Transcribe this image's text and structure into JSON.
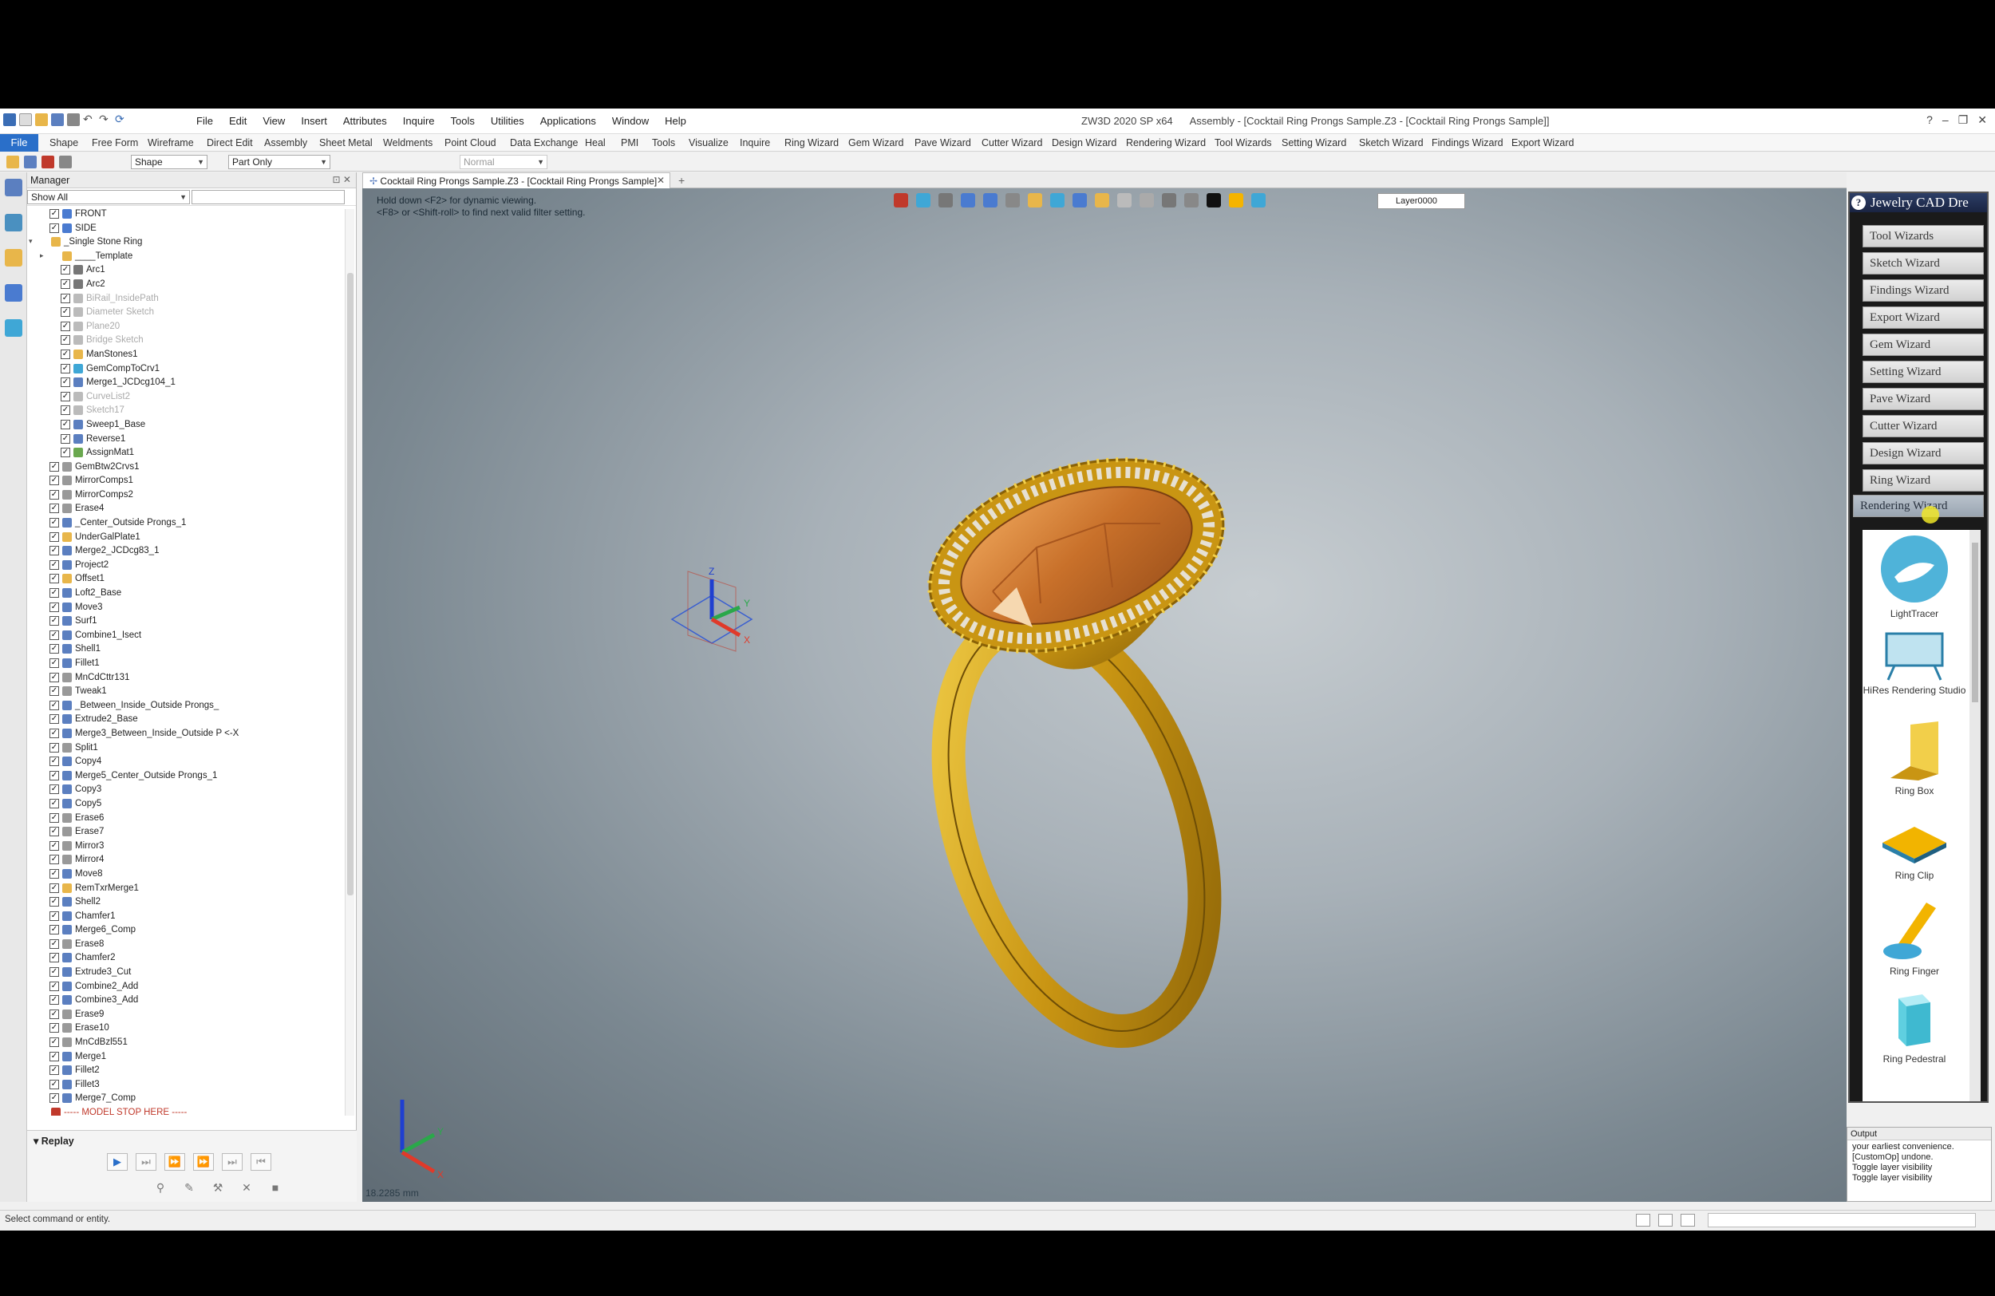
{
  "window": {
    "title": "ZW3D 2020 SP x64",
    "document_title": "Assembly - [Cocktail Ring Prongs Sample.Z3 - [Cocktail Ring Prongs Sample]]"
  },
  "menu": [
    "File",
    "Edit",
    "View",
    "Insert",
    "Attributes",
    "Inquire",
    "Tools",
    "Utilities",
    "Applications",
    "Window",
    "Help"
  ],
  "ribbon_tabs": [
    "File",
    "Shape",
    "Free Form",
    "Wireframe",
    "Direct Edit",
    "Assembly",
    "Sheet Metal",
    "Weldments",
    "Point Cloud",
    "Data Exchange",
    "Heal",
    "PMI",
    "Tools",
    "Visualize",
    "Inquire",
    "Ring Wizard",
    "Gem Wizard",
    "Pave Wizard",
    "Cutter Wizard",
    "Design Wizard",
    "Rendering Wizard",
    "Tool Wizards",
    "Setting Wizard",
    "Sketch Wizard",
    "Findings Wizard",
    "Export Wizard"
  ],
  "toolbar": {
    "filter_combo": "Shape",
    "scope_combo": "Part Only",
    "render_combo": "Normal"
  },
  "manager": {
    "title": "Manager",
    "filter": "Show All",
    "tree": [
      {
        "label": "FRONT",
        "level": 2,
        "checked": true,
        "icon": "plane-icon",
        "color": "#4a7bd0"
      },
      {
        "label": "SIDE",
        "level": 2,
        "checked": true,
        "icon": "plane-icon",
        "color": "#4a7bd0"
      },
      {
        "label": "_Single Stone Ring",
        "level": 1,
        "checked": false,
        "icon": "folder-icon",
        "color": "#e8b64a",
        "expand": "v"
      },
      {
        "label": "____Template",
        "level": 2,
        "checked": false,
        "icon": "folder-icon",
        "color": "#e8b64a",
        "expand": ">"
      },
      {
        "label": "Arc1",
        "level": 3,
        "checked": true,
        "icon": "arc-icon",
        "color": "#777"
      },
      {
        "label": "Arc2",
        "level": 3,
        "checked": true,
        "icon": "arc-icon",
        "color": "#777"
      },
      {
        "label": "BiRail_InsidePath",
        "level": 3,
        "checked": true,
        "icon": "curve-icon",
        "color": "#bbb",
        "dim": true
      },
      {
        "label": "Diameter Sketch",
        "level": 3,
        "checked": true,
        "icon": "sketch-icon",
        "color": "#bbb",
        "dim": true
      },
      {
        "label": "Plane20",
        "level": 3,
        "checked": true,
        "icon": "plane-icon",
        "color": "#bbb",
        "dim": true
      },
      {
        "label": "Bridge Sketch",
        "level": 3,
        "checked": true,
        "icon": "sketch-icon",
        "color": "#bbb",
        "dim": true
      },
      {
        "label": "ManStones1",
        "level": 3,
        "checked": true,
        "icon": "stone-icon",
        "color": "#e8b64a"
      },
      {
        "label": "GemCompToCrv1",
        "level": 3,
        "checked": true,
        "icon": "gem-icon",
        "color": "#3fa7d6"
      },
      {
        "label": "Merge1_JCDcg104_1",
        "level": 3,
        "checked": true,
        "icon": "merge-icon",
        "color": "#5b7fc0"
      },
      {
        "label": "CurveList2",
        "level": 3,
        "checked": true,
        "icon": "curve-icon",
        "color": "#bbb",
        "dim": true
      },
      {
        "label": "Sketch17",
        "level": 3,
        "checked": true,
        "icon": "sketch-icon",
        "color": "#bbb",
        "dim": true
      },
      {
        "label": "Sweep1_Base",
        "level": 3,
        "checked": true,
        "icon": "sweep-icon",
        "color": "#5b7fc0"
      },
      {
        "label": "Reverse1",
        "level": 3,
        "checked": true,
        "icon": "reverse-icon",
        "color": "#5b7fc0"
      },
      {
        "label": "AssignMat1",
        "level": 3,
        "checked": true,
        "icon": "material-icon",
        "color": "#6aa84f"
      },
      {
        "label": "GemBtw2Crvs1",
        "level": 2,
        "checked": true,
        "icon": "gem-icon",
        "color": "#999"
      },
      {
        "label": "MirrorComps1",
        "level": 2,
        "checked": true,
        "icon": "mirror-icon",
        "color": "#999"
      },
      {
        "label": "MirrorComps2",
        "level": 2,
        "checked": true,
        "icon": "mirror-icon",
        "color": "#999"
      },
      {
        "label": "Erase4",
        "level": 2,
        "checked": true,
        "icon": "erase-icon",
        "color": "#999"
      },
      {
        "label": "_Center_Outside Prongs_1",
        "level": 2,
        "checked": true,
        "icon": "prong-icon",
        "color": "#5b7fc0"
      },
      {
        "label": "UnderGalPlate1",
        "level": 2,
        "checked": true,
        "icon": "plate-icon",
        "color": "#e8b64a"
      },
      {
        "label": "Merge2_JCDcg83_1",
        "level": 2,
        "checked": true,
        "icon": "merge-icon",
        "color": "#5b7fc0"
      },
      {
        "label": "Project2",
        "level": 2,
        "checked": true,
        "icon": "project-icon",
        "color": "#5b7fc0"
      },
      {
        "label": "Offset1",
        "level": 2,
        "checked": true,
        "icon": "offset-icon",
        "color": "#e8b64a"
      },
      {
        "label": "Loft2_Base",
        "level": 2,
        "checked": true,
        "icon": "loft-icon",
        "color": "#5b7fc0"
      },
      {
        "label": "Move3",
        "level": 2,
        "checked": true,
        "icon": "move-icon",
        "color": "#5b7fc0"
      },
      {
        "label": "Surf1",
        "level": 2,
        "checked": true,
        "icon": "surface-icon",
        "color": "#5b7fc0"
      },
      {
        "label": "Combine1_Isect",
        "level": 2,
        "checked": true,
        "icon": "combine-icon",
        "color": "#5b7fc0"
      },
      {
        "label": "Shell1",
        "level": 2,
        "checked": true,
        "icon": "shell-icon",
        "color": "#5b7fc0"
      },
      {
        "label": "Fillet1",
        "level": 2,
        "checked": true,
        "icon": "fillet-icon",
        "color": "#5b7fc0"
      },
      {
        "label": "MnCdCttr131",
        "level": 2,
        "checked": true,
        "icon": "cutter-icon",
        "color": "#999"
      },
      {
        "label": "Tweak1",
        "level": 2,
        "checked": true,
        "icon": "tweak-icon",
        "color": "#999"
      },
      {
        "label": "_Between_Inside_Outside Prongs_",
        "level": 2,
        "checked": true,
        "icon": "prong-icon",
        "color": "#5b7fc0"
      },
      {
        "label": "Extrude2_Base",
        "level": 2,
        "checked": true,
        "icon": "extrude-icon",
        "color": "#5b7fc0"
      },
      {
        "label": "Merge3_Between_Inside_Outside P <-X",
        "level": 2,
        "checked": true,
        "icon": "merge-icon",
        "color": "#5b7fc0"
      },
      {
        "label": "Split1",
        "level": 2,
        "checked": true,
        "icon": "split-icon",
        "color": "#999"
      },
      {
        "label": "Copy4",
        "level": 2,
        "checked": true,
        "icon": "copy-icon",
        "color": "#5b7fc0"
      },
      {
        "label": "Merge5_Center_Outside Prongs_1",
        "level": 2,
        "checked": true,
        "icon": "merge-icon",
        "color": "#5b7fc0"
      },
      {
        "label": "Copy3",
        "level": 2,
        "checked": true,
        "icon": "copy-icon",
        "color": "#5b7fc0"
      },
      {
        "label": "Copy5",
        "level": 2,
        "checked": true,
        "icon": "copy-icon",
        "color": "#5b7fc0"
      },
      {
        "label": "Erase6",
        "level": 2,
        "checked": true,
        "icon": "erase-icon",
        "color": "#999"
      },
      {
        "label": "Erase7",
        "level": 2,
        "checked": true,
        "icon": "erase-icon",
        "color": "#999"
      },
      {
        "label": "Mirror3",
        "level": 2,
        "checked": true,
        "icon": "mirror-icon",
        "color": "#999"
      },
      {
        "label": "Mirror4",
        "level": 2,
        "checked": true,
        "icon": "mirror-icon",
        "color": "#999"
      },
      {
        "label": "Move8",
        "level": 2,
        "checked": true,
        "icon": "move-icon",
        "color": "#5b7fc0"
      },
      {
        "label": "RemTxrMerge1",
        "level": 2,
        "checked": true,
        "icon": "merge-icon",
        "color": "#e8b64a"
      },
      {
        "label": "Shell2",
        "level": 2,
        "checked": true,
        "icon": "shell-icon",
        "color": "#5b7fc0"
      },
      {
        "label": "Chamfer1",
        "level": 2,
        "checked": true,
        "icon": "chamfer-icon",
        "color": "#5b7fc0"
      },
      {
        "label": "Merge6_Comp",
        "level": 2,
        "checked": true,
        "icon": "merge-icon",
        "color": "#5b7fc0"
      },
      {
        "label": "Erase8",
        "level": 2,
        "checked": true,
        "icon": "erase-icon",
        "color": "#999"
      },
      {
        "label": "Chamfer2",
        "level": 2,
        "checked": true,
        "icon": "chamfer-icon",
        "color": "#5b7fc0"
      },
      {
        "label": "Extrude3_Cut",
        "level": 2,
        "checked": true,
        "icon": "extrude-icon",
        "color": "#5b7fc0"
      },
      {
        "label": "Combine2_Add",
        "level": 2,
        "checked": true,
        "icon": "combine-icon",
        "color": "#5b7fc0"
      },
      {
        "label": "Combine3_Add",
        "level": 2,
        "checked": true,
        "icon": "combine-icon",
        "color": "#5b7fc0"
      },
      {
        "label": "Erase9",
        "level": 2,
        "checked": true,
        "icon": "erase-icon",
        "color": "#999"
      },
      {
        "label": "Erase10",
        "level": 2,
        "checked": true,
        "icon": "erase-icon",
        "color": "#999"
      },
      {
        "label": "MnCdBzl551",
        "level": 2,
        "checked": true,
        "icon": "bezel-icon",
        "color": "#999"
      },
      {
        "label": "Merge1",
        "level": 2,
        "checked": true,
        "icon": "merge-icon",
        "color": "#5b7fc0"
      },
      {
        "label": "Fillet2",
        "level": 2,
        "checked": true,
        "icon": "fillet-icon",
        "color": "#5b7fc0"
      },
      {
        "label": "Fillet3",
        "level": 2,
        "checked": true,
        "icon": "fillet-icon",
        "color": "#5b7fc0"
      },
      {
        "label": "Merge7_Comp",
        "level": 2,
        "checked": true,
        "icon": "merge-icon",
        "color": "#5b7fc0"
      },
      {
        "label": "----- MODEL STOP HERE -----",
        "level": 1,
        "checked": false,
        "icon": "stop-arrow-icon",
        "color": "#c0392b",
        "stop": true
      }
    ]
  },
  "replay": {
    "title": "Replay"
  },
  "document_tab": "Cocktail Ring Prongs Sample.Z3 - [Cocktail Ring Prongs Sample]",
  "viewport": {
    "hint_line1": "Hold down <F2> for dynamic viewing.",
    "hint_line2": "<F8> or <Shift-roll> to find next valid filter setting.",
    "layer": "Layer0000",
    "scale": "18.2285 mm",
    "triad_labels": {
      "x": "X",
      "y": "Y",
      "z": "Z"
    }
  },
  "jewelry_panel": {
    "title": "Jewelry CAD Dre",
    "buttons": [
      "Tool Wizards",
      "Sketch Wizard",
      "Findings Wizard",
      "Export Wizard",
      "Gem Wizard",
      "Setting Wizard",
      "Pave Wizard",
      "Cutter Wizard",
      "Design Wizard",
      "Ring Wizard",
      "Rendering Wizard"
    ],
    "active": "Rendering Wizard",
    "gallery": [
      "LightTracer",
      "HiRes Rendering Studio",
      "Ring Box",
      "Ring Clip",
      "Ring Finger",
      "Ring Pedestral"
    ]
  },
  "output": {
    "title": "Output",
    "lines": [
      "your earliest convenience.",
      "[CustomOp] undone.",
      "Toggle layer visibility",
      "Toggle layer visibility"
    ]
  },
  "status": {
    "text": "Select command or entity."
  },
  "colors": {
    "accent": "#2a6fc9",
    "gold": "#d4a017",
    "gem": "#d9823b"
  }
}
